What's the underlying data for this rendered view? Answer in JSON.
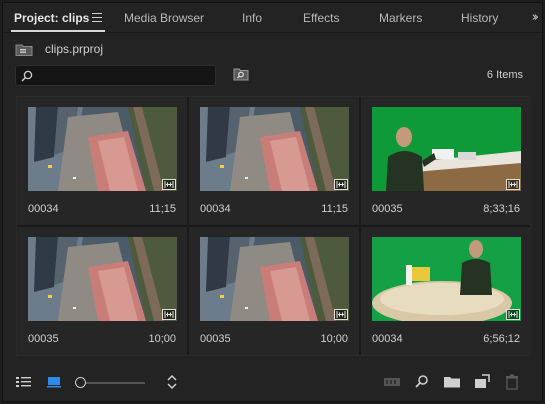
{
  "tabs": [
    {
      "label": "Project: clips",
      "active": true
    },
    {
      "label": "Media Browser",
      "active": false
    },
    {
      "label": "Info",
      "active": false
    },
    {
      "label": "Effects",
      "active": false
    },
    {
      "label": "Markers",
      "active": false
    },
    {
      "label": "History",
      "active": false
    }
  ],
  "project": {
    "file": "clips.prproj"
  },
  "search": {
    "value": "",
    "placeholder": ""
  },
  "item_count": "6 Items",
  "clips": [
    {
      "name": "00034",
      "duration": "11;15",
      "thumb": "city-aerial"
    },
    {
      "name": "00034",
      "duration": "11;15",
      "thumb": "city-aerial"
    },
    {
      "name": "00035",
      "duration": "8;33;16",
      "thumb": "greenscreen-man"
    },
    {
      "name": "00035",
      "duration": "10;00",
      "thumb": "city-aerial"
    },
    {
      "name": "00035",
      "duration": "10;00",
      "thumb": "city-aerial"
    },
    {
      "name": "00034",
      "duration": "6;56;12",
      "thumb": "greenscreen-table"
    }
  ],
  "icons": {
    "menu": "hamburger-icon",
    "overflow": "double-chevron-right-icon",
    "bin": "bin-icon",
    "search": "search-icon",
    "find": "find-icon",
    "clip_badge": "audio-video-clip-icon",
    "list_view": "list-view-icon",
    "icon_view": "icon-view-icon",
    "sort": "sort-icon",
    "automate": "automate-to-sequence-icon",
    "find_bottom": "find-icon",
    "new_bin": "new-bin-icon",
    "new_item": "new-item-icon",
    "clear": "trash-icon"
  },
  "colors": {
    "panel_bg": "#232323",
    "grid_bg": "#1a1a1a",
    "accent_blue": "#2d8ceb",
    "text": "#d0d0d0"
  }
}
